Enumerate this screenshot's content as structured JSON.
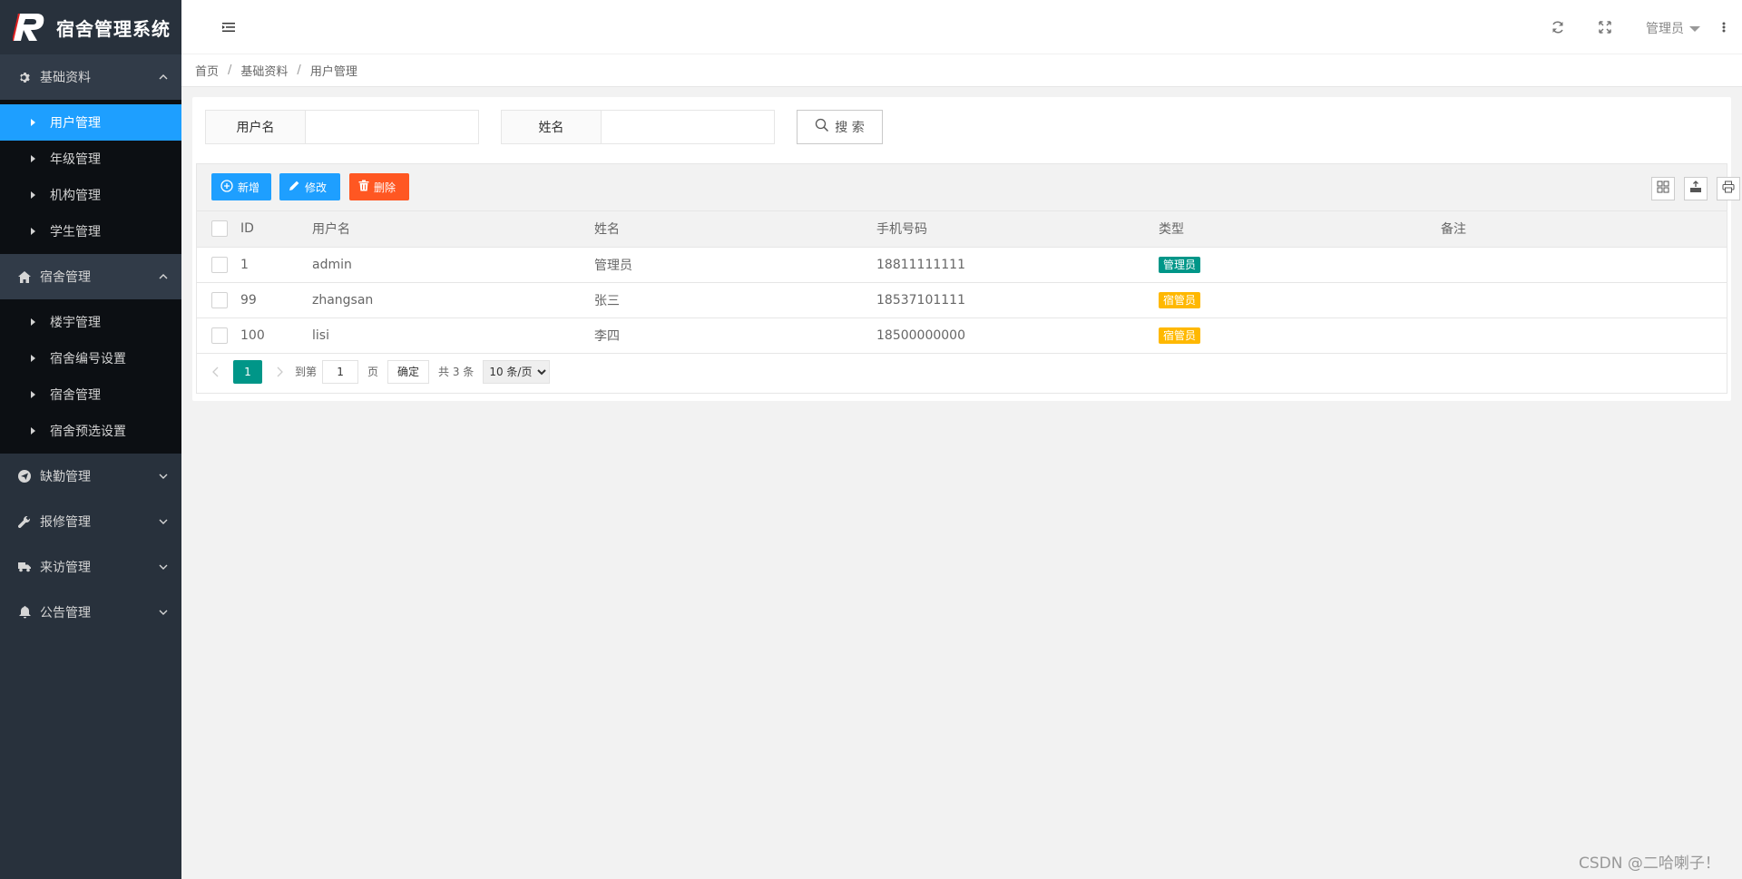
{
  "app": {
    "title": "宿舍管理系统"
  },
  "sidebar": {
    "groups": [
      {
        "label": "基础资料",
        "icon": "gear-icon",
        "expanded": true,
        "items": [
          {
            "label": "用户管理",
            "active": true
          },
          {
            "label": "年级管理"
          },
          {
            "label": "机构管理"
          },
          {
            "label": "学生管理"
          }
        ]
      },
      {
        "label": "宿舍管理",
        "icon": "home-icon",
        "expanded": true,
        "items": [
          {
            "label": "楼宇管理"
          },
          {
            "label": "宿舍编号设置"
          },
          {
            "label": "宿舍管理"
          },
          {
            "label": "宿舍预选设置"
          }
        ]
      },
      {
        "label": "缺勤管理",
        "icon": "send-icon",
        "expanded": false
      },
      {
        "label": "报修管理",
        "icon": "wrench-icon",
        "expanded": false
      },
      {
        "label": "来访管理",
        "icon": "truck-icon",
        "expanded": false
      },
      {
        "label": "公告管理",
        "icon": "bell-icon",
        "expanded": false
      }
    ]
  },
  "header": {
    "user": "管理员"
  },
  "breadcrumb": [
    "首页",
    "基础资料",
    "用户管理"
  ],
  "search": {
    "username_label": "用户名",
    "username_value": "",
    "name_label": "姓名",
    "name_value": "",
    "button": "搜 索"
  },
  "toolbar": {
    "add": "新增",
    "edit": "修改",
    "delete": "删除"
  },
  "table": {
    "columns": [
      "ID",
      "用户名",
      "姓名",
      "手机号码",
      "类型",
      "备注"
    ],
    "rows": [
      {
        "id": "1",
        "username": "admin",
        "name": "管理员",
        "phone": "18811111111",
        "type": "管理员",
        "type_color": "#009688",
        "note": ""
      },
      {
        "id": "99",
        "username": "zhangsan",
        "name": "张三",
        "phone": "18537101111",
        "type": "宿管员",
        "type_color": "#ffb800",
        "note": ""
      },
      {
        "id": "100",
        "username": "lisi",
        "name": "李四",
        "phone": "18500000000",
        "type": "宿管员",
        "type_color": "#ffb800",
        "note": ""
      }
    ]
  },
  "pager": {
    "current": "1",
    "goto_label": "到第",
    "goto_value": "1",
    "page_unit": "页",
    "confirm": "确定",
    "total": "共 3 条",
    "page_size": "10 条/页"
  },
  "watermark": "CSDN @二哈喇子！",
  "colors": {
    "sidebar_bg": "#28313c",
    "active": "#1e9fff",
    "danger": "#ff5722",
    "primary_green": "#009688",
    "warn": "#ffb800"
  }
}
